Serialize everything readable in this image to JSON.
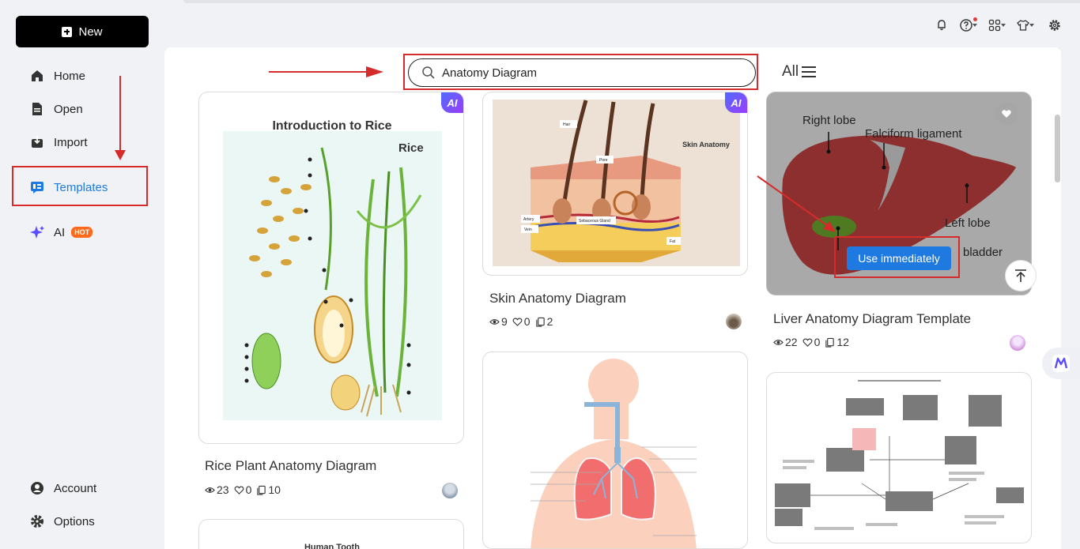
{
  "sidebar": {
    "new_label": "New",
    "items": [
      {
        "label": "Home",
        "icon": "home-icon"
      },
      {
        "label": "Open",
        "icon": "file-icon"
      },
      {
        "label": "Import",
        "icon": "import-icon"
      },
      {
        "label": "Templates",
        "icon": "templates-icon"
      },
      {
        "label": "AI",
        "icon": "sparkle-icon",
        "badge": "HOT"
      }
    ],
    "bottom": [
      {
        "label": "Account",
        "icon": "account-icon"
      },
      {
        "label": "Options",
        "icon": "gear-icon"
      }
    ]
  },
  "search": {
    "value": "Anatomy Diagram",
    "icon": "search-icon"
  },
  "filter": {
    "label": "All",
    "icon": "menu-icon"
  },
  "cards": [
    {
      "title": "Rice Plant Anatomy Diagram",
      "views": "23",
      "likes": "0",
      "copies": "10",
      "badge": "AI",
      "thumb": {
        "heading": "Introduction to Rice",
        "subheading": "Rice"
      }
    },
    {
      "title": "Skin Anatomy Diagram",
      "views": "9",
      "likes": "0",
      "copies": "2",
      "badge": "AI",
      "thumb": {
        "heading": "Skin Anatomy",
        "labels": [
          "Hair",
          "Pore",
          "Artery",
          "Sebaceous Gland",
          "Vein",
          "Fat"
        ]
      }
    },
    {
      "title": "Liver Anatomy Diagram Template",
      "views": "22",
      "likes": "0",
      "copies": "12",
      "thumb": {
        "labels": [
          "Right lobe",
          "Falciform ligament",
          "Left lobe",
          "bladder"
        ]
      },
      "action_label": "Use immediately"
    },
    {
      "title": "",
      "thumb": {
        "heading": "Human Tooth"
      }
    },
    {
      "title": ""
    },
    {
      "title": ""
    }
  ],
  "colors": {
    "accent": "#1e7ae0",
    "annotation": "#d62b2b",
    "hot": "#ff6a1a"
  }
}
